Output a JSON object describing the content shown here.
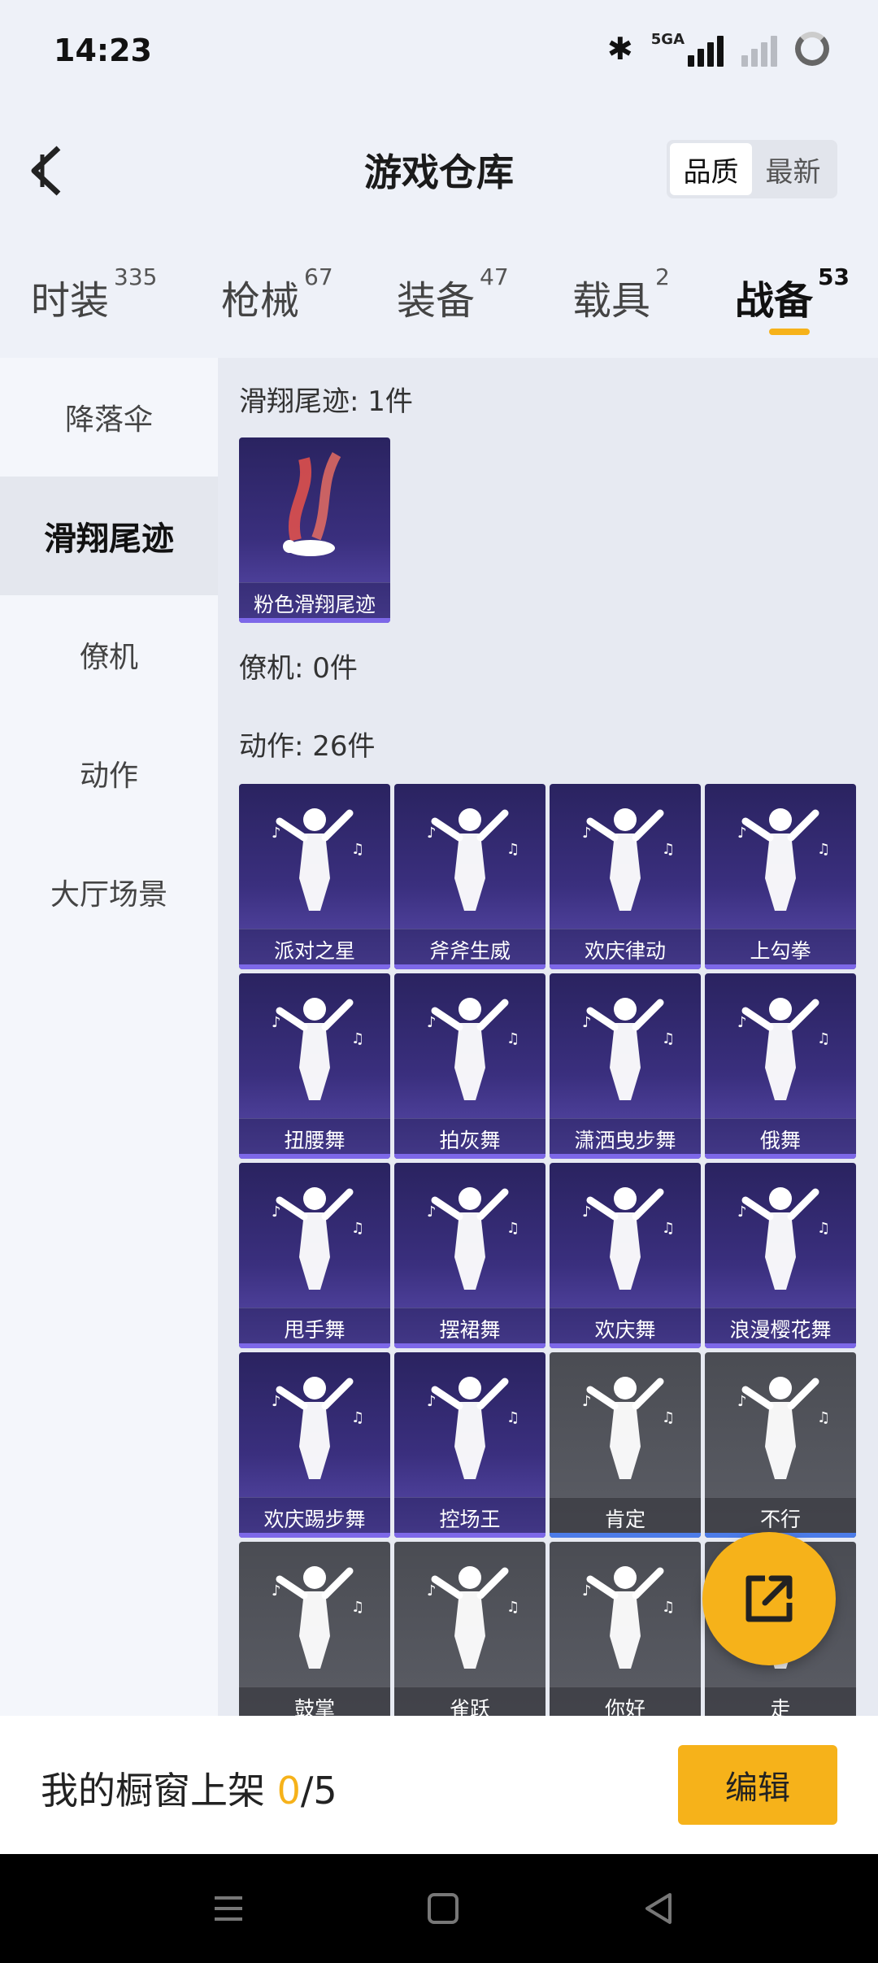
{
  "status": {
    "time": "14:23",
    "network": "5GA"
  },
  "header": {
    "title": "游戏仓库",
    "sort_quality": "品质",
    "sort_latest": "最新"
  },
  "tabs": [
    {
      "label": "时装",
      "count": "335"
    },
    {
      "label": "枪械",
      "count": "67"
    },
    {
      "label": "装备",
      "count": "47"
    },
    {
      "label": "载具",
      "count": "2"
    },
    {
      "label": "战备",
      "count": "53"
    }
  ],
  "sidebar": [
    "降落伞",
    "滑翔尾迹",
    "僚机",
    "动作",
    "大厅场景"
  ],
  "sections": {
    "trail_title": "滑翔尾迹: 1件",
    "trail_items": [
      "粉色滑翔尾迹"
    ],
    "wingman_title": "僚机: 0件",
    "actions_title": "动作: 26件"
  },
  "actions": [
    "派对之星",
    "斧斧生威",
    "欢庆律动",
    "上勾拳",
    "扭腰舞",
    "拍灰舞",
    "潇洒曳步舞",
    "俄舞",
    "甩手舞",
    "摆裙舞",
    "欢庆舞",
    "浪漫樱花舞",
    "欢庆踢步舞",
    "控场王",
    "肯定",
    "不行",
    "鼓掌",
    "雀跃",
    "你好",
    "走"
  ],
  "bottom": {
    "text_prefix": "我的橱窗上架 ",
    "count": "0",
    "text_suffix": "/5",
    "edit_label": "编辑"
  },
  "colors": {
    "accent": "#f6b21a",
    "card_purple": "#3a2f7e",
    "card_grey": "#55575e"
  }
}
